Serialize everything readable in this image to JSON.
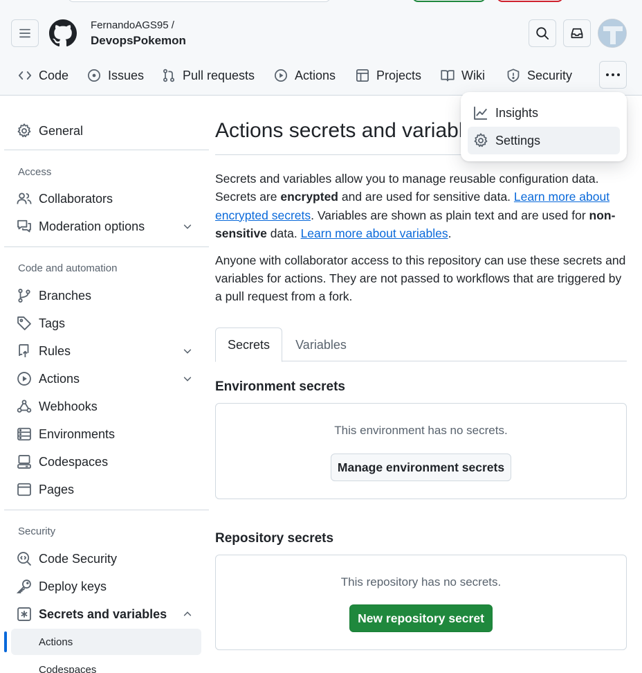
{
  "header": {
    "owner": "FernandoAGS95 /",
    "repo": "DevopsPokemon",
    "avatar_initial": "T",
    "tabs": [
      {
        "label": "Code",
        "icon": "code-icon"
      },
      {
        "label": "Issues",
        "icon": "issue-opened-icon"
      },
      {
        "label": "Pull requests",
        "icon": "git-pull-request-icon"
      },
      {
        "label": "Actions",
        "icon": "play-icon"
      },
      {
        "label": "Projects",
        "icon": "table-icon"
      },
      {
        "label": "Wiki",
        "icon": "book-icon"
      },
      {
        "label": "Security",
        "icon": "shield-icon"
      }
    ]
  },
  "dropdown": {
    "items": [
      {
        "label": "Insights",
        "icon": "graph-icon"
      },
      {
        "label": "Settings",
        "icon": "gear-icon"
      }
    ]
  },
  "sidebar": {
    "general": "General",
    "sections": [
      {
        "heading": "Access",
        "items": [
          "Collaborators",
          "Moderation options"
        ]
      },
      {
        "heading": "Code and automation",
        "items": [
          "Branches",
          "Tags",
          "Rules",
          "Actions",
          "Webhooks",
          "Environments",
          "Codespaces",
          "Pages"
        ]
      },
      {
        "heading": "Security",
        "items": [
          "Code Security",
          "Deploy keys",
          "Secrets and variables"
        ]
      }
    ],
    "sub_items": [
      "Actions",
      "Codespaces"
    ]
  },
  "main": {
    "title": "Actions secrets and variables",
    "desc": {
      "p1": "Secrets and variables allow you to manage reusable configuration data. Secrets are ",
      "bold1": "encrypted",
      "p2": " and are used for sensitive data. ",
      "link1": "Learn more about encrypted secrets",
      "p3": ". Variables are shown as plain text and are used for ",
      "bold2": "non-sensitive",
      "p4": " data. ",
      "link2": "Learn more about variables",
      "p5": "."
    },
    "desc2": "Anyone with collaborator access to this repository can use these secrets and variables for actions. They are not passed to workflows that are triggered by a pull request from a fork.",
    "tabs": [
      "Secrets",
      "Variables"
    ],
    "env": {
      "title": "Environment secrets",
      "empty": "This environment has no secrets.",
      "button": "Manage environment secrets"
    },
    "repo": {
      "title": "Repository secrets",
      "empty": "This repository has no secrets.",
      "button": "New repository secret"
    }
  },
  "colors": {
    "accent": "#0969da",
    "primary_button": "#1f883d",
    "border": "#d1d9e0",
    "muted_text": "#59636e"
  }
}
